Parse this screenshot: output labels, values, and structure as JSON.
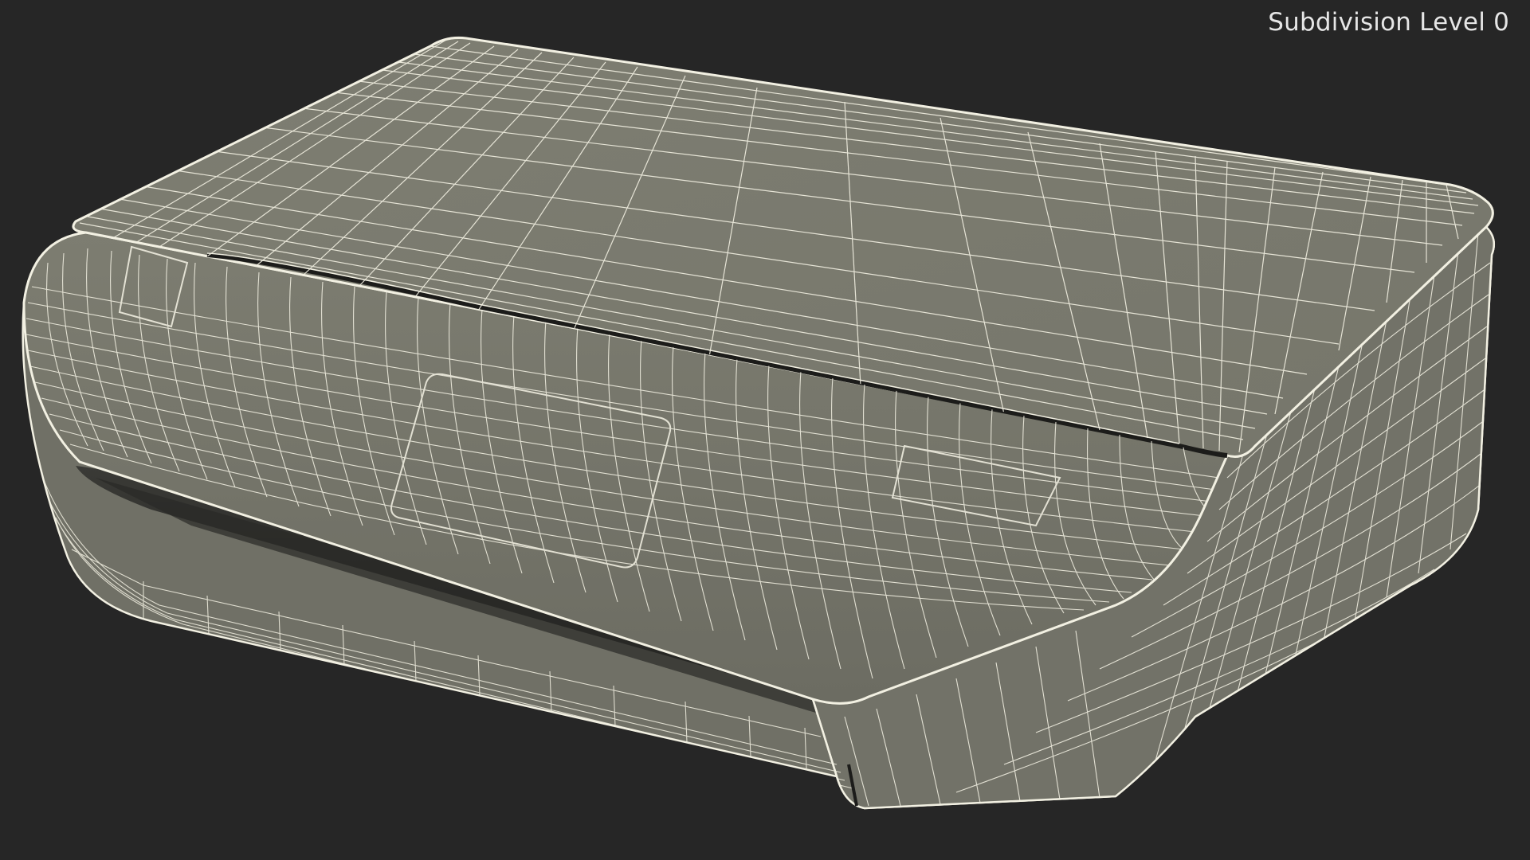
{
  "viewport": {
    "label": "Subdivision Level 0",
    "colors": {
      "background": "#262626",
      "surface": "#7a7a6e",
      "surface_dark": "#6a6a60",
      "wire": "#f2f0e2",
      "label": "#e6e6e6"
    }
  },
  "model": {
    "subject": "printer-wireframe-icon"
  }
}
